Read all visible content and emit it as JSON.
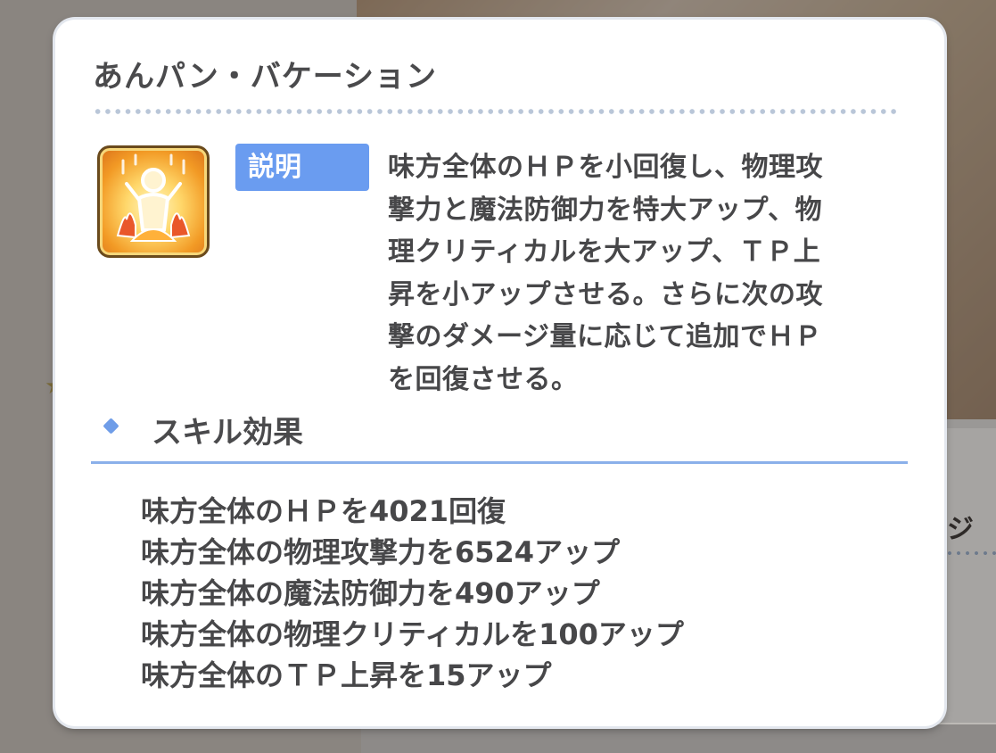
{
  "background": {
    "partial_text": "ジ"
  },
  "popup": {
    "title": "あんパン・バケーション",
    "skill_icon": "skill-buff-aura-icon",
    "description_label": "説明",
    "description": "味方全体のＨＰを小回復し、物理攻\n撃力と魔法防御力を特大アップ、物\n理クリティカルを大アップ、ＴＰ上\n昇を小アップさせる。さらに次の攻\n撃のダメージ量に応じて追加でＨＰ\nを回復させる。",
    "effects_heading": "スキル効果",
    "effects": [
      "味方全体のＨＰを4021回復",
      "味方全体の物理攻撃力を6524アップ",
      "味方全体の魔法防御力を490アップ",
      "味方全体の物理クリティカルを100アップ",
      "味方全体のＴＰ上昇を15アップ"
    ]
  },
  "colors": {
    "accent_blue": "#6a9cf0",
    "text_dark": "#474749",
    "divider_blue": "#8bb0ea"
  }
}
